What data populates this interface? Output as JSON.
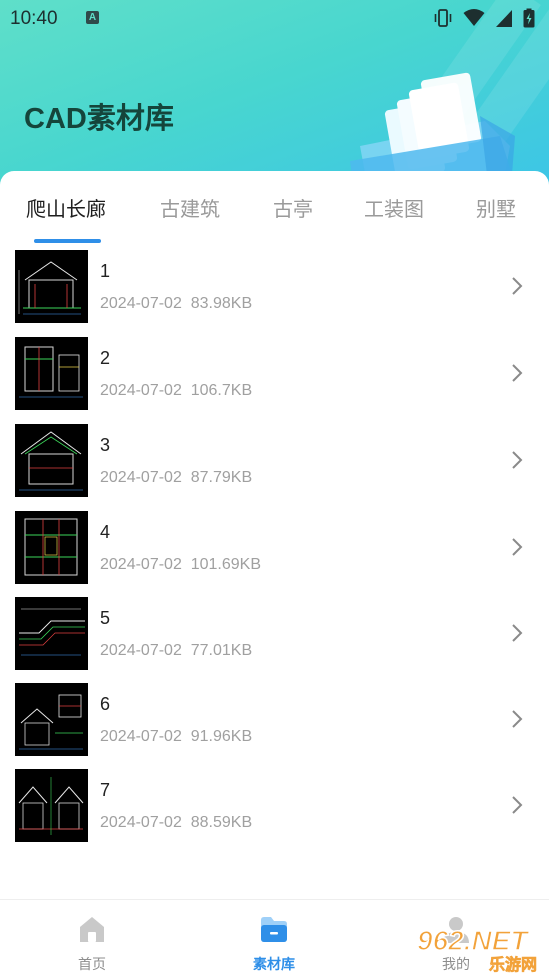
{
  "status_bar": {
    "time": "10:40",
    "notification_letter": "A"
  },
  "header": {
    "title": "CAD素材库"
  },
  "tabs": [
    {
      "label": "爬山长廊",
      "active": true
    },
    {
      "label": "古建筑",
      "active": false
    },
    {
      "label": "古亭",
      "active": false
    },
    {
      "label": "工装图",
      "active": false
    },
    {
      "label": "别墅",
      "active": false
    }
  ],
  "items": [
    {
      "name": "1",
      "date": "2024-07-02",
      "size": "83.98KB"
    },
    {
      "name": "2",
      "date": "2024-07-02",
      "size": "106.7KB"
    },
    {
      "name": "3",
      "date": "2024-07-02",
      "size": "87.79KB"
    },
    {
      "name": "4",
      "date": "2024-07-02",
      "size": "101.69KB"
    },
    {
      "name": "5",
      "date": "2024-07-02",
      "size": "77.01KB"
    },
    {
      "name": "6",
      "date": "2024-07-02",
      "size": "91.96KB"
    },
    {
      "name": "7",
      "date": "2024-07-02",
      "size": "88.59KB"
    }
  ],
  "bottom_nav": [
    {
      "label": "首页",
      "icon": "home-icon",
      "active": false
    },
    {
      "label": "素材库",
      "icon": "folder-icon",
      "active": true
    },
    {
      "label": "我的",
      "icon": "user-icon",
      "active": false
    }
  ],
  "watermark": {
    "text": "962.NET",
    "subtext": "乐游网"
  },
  "colors": {
    "accent": "#2f8fe8",
    "header_start": "#5fdfc9",
    "header_end": "#3cc4e8",
    "title": "#15453b"
  }
}
